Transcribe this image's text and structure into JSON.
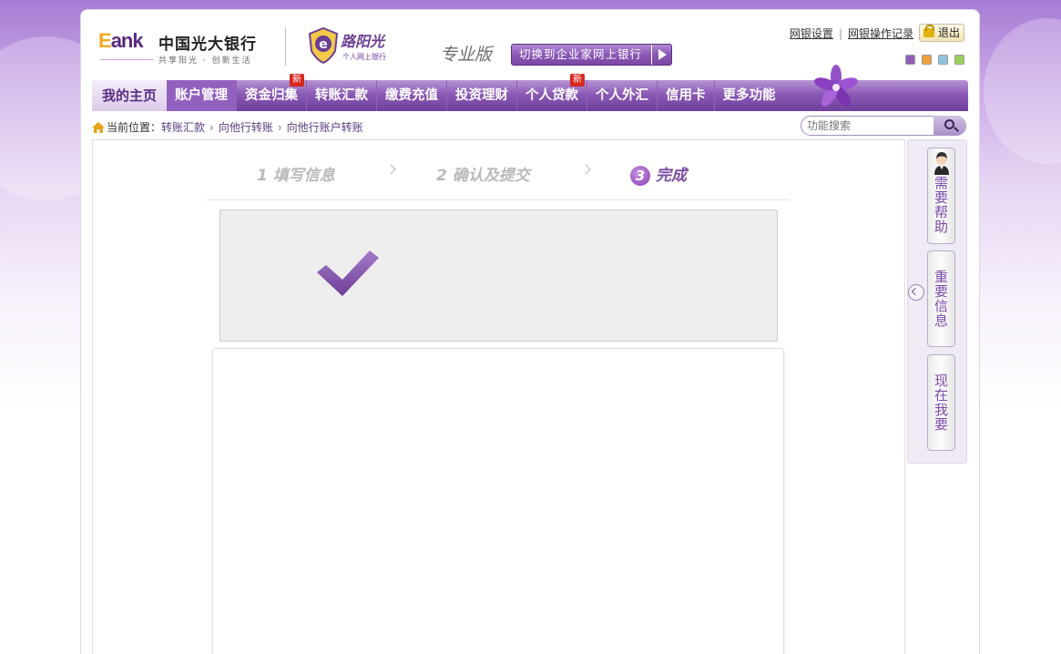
{
  "header": {
    "logo_brand": "Eank",
    "logo_name": "中国光大银行",
    "logo_slogan": "共享阳光 · 创新生活",
    "sub_brand": "路阳光",
    "sub_brand_caption": "个人网上银行",
    "edition": "专业版",
    "switch_button": "切换到企业家网上银行",
    "links": [
      "网银设置",
      "网银操作记录"
    ],
    "logout": "退出",
    "theme_colors": [
      "#8f5fb6",
      "#f1a23a",
      "#8fc3de",
      "#9bd05a"
    ]
  },
  "nav": {
    "home": "我的主页",
    "items": [
      {
        "label": "账户管理",
        "badge": ""
      },
      {
        "label": "资金归集",
        "badge": "新"
      },
      {
        "label": "转账汇款",
        "badge": ""
      },
      {
        "label": "缴费充值",
        "badge": ""
      },
      {
        "label": "投资理财",
        "badge": ""
      },
      {
        "label": "个人贷款",
        "badge": "新"
      },
      {
        "label": "个人外汇",
        "badge": ""
      },
      {
        "label": "信用卡",
        "badge": ""
      },
      {
        "label": "更多功能",
        "badge": ""
      }
    ],
    "active_index": 0
  },
  "breadcrumb": {
    "prefix": "当前位置：",
    "items": [
      "转账汇款",
      "向他行转账",
      "向他行账户转账"
    ]
  },
  "search": {
    "placeholder": "功能搜索"
  },
  "steps": [
    {
      "label": "1 填写信息",
      "state": "done"
    },
    {
      "label": "2 确认及提交",
      "state": "done"
    },
    {
      "num": "3",
      "label": "完成",
      "state": "current"
    }
  ],
  "sidebar": {
    "help": "需要帮助",
    "info": "重要信息",
    "now": "现在我要"
  }
}
